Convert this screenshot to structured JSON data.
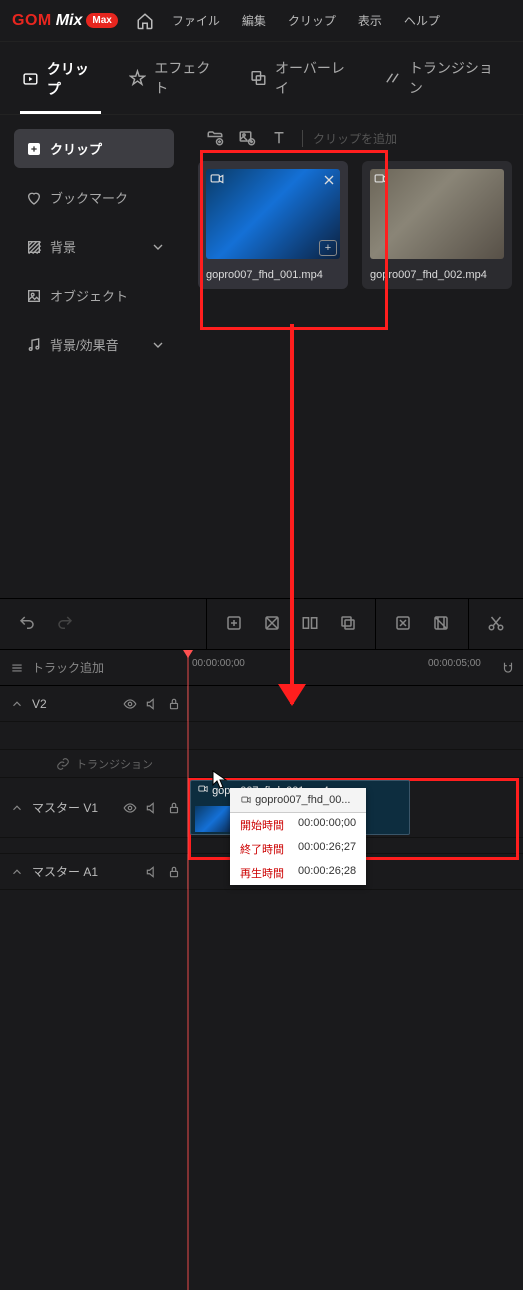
{
  "logo": {
    "gom": "GOM",
    "mix": "Mix",
    "max": "Max"
  },
  "menu": {
    "file": "ファイル",
    "edit": "編集",
    "clip": "クリップ",
    "view": "表示",
    "help": "ヘルプ"
  },
  "tabs": {
    "clip": "クリップ",
    "effect": "エフェクト",
    "overlay": "オーバーレイ",
    "transition": "トランジション"
  },
  "sidebar": {
    "clip": "クリップ",
    "bookmark": "ブックマーク",
    "background": "背景",
    "object": "オブジェクト",
    "bgm": "背景/効果音"
  },
  "clips_toolbar": {
    "placeholder": "クリップを追加"
  },
  "thumbs": {
    "item1": "gopro007_fhd_001.mp4",
    "item2": "gopro007_fhd_002.mp4"
  },
  "ruler": {
    "track_add": "トラック追加",
    "t0": "00:00:00;00",
    "t1": "00:00:05;00"
  },
  "tracks": {
    "v2": "V2",
    "transition": "トランジション",
    "master_v1": "マスター V1",
    "master_a1": "マスター A1"
  },
  "clip_block": {
    "name": "gopro007_fhd_001.mp4"
  },
  "tooltip": {
    "title": "gopro007_fhd_00...",
    "start_k": "開始時間",
    "start_v": "00:00:00;00",
    "end_k": "終了時間",
    "end_v": "00:00:26;27",
    "dur_k": "再生時間",
    "dur_v": "00:00:26;28"
  }
}
